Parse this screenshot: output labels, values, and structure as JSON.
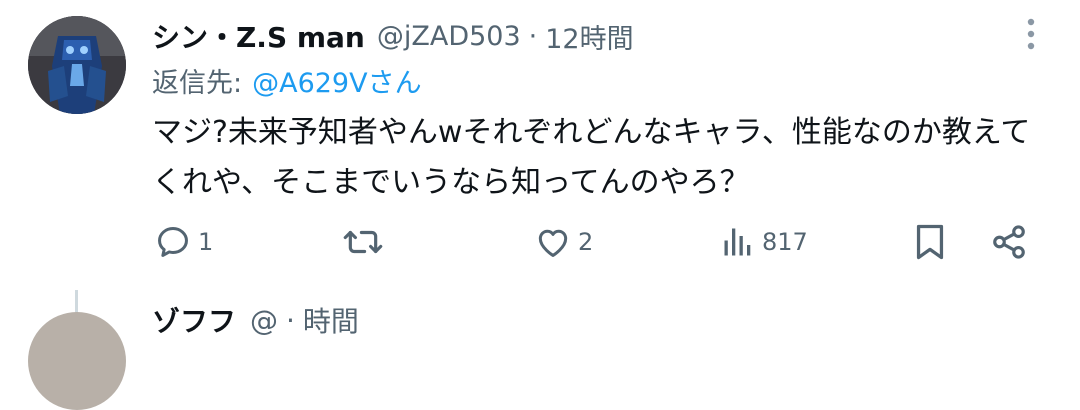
{
  "tweet": {
    "author_name": "シン・Z.S man",
    "handle": "@jZAD503",
    "separator": "·",
    "time": "12時間",
    "reply_label": "返信先:",
    "reply_handle": "@A629Vさん",
    "text": "マジ?未来予知者やんwそれぞれどんなキャラ、性能なのか教えてくれや、そこまでいうなら知ってんのやろ？",
    "actions": {
      "reply_icon": "reply-icon",
      "reply_count": "1",
      "retweet_icon": "retweet-icon",
      "like_icon": "heart-icon",
      "like_count": "2",
      "views_icon": "views-icon",
      "views_count": "817",
      "bookmark_icon": "bookmark-icon",
      "share_icon": "share-icon"
    }
  },
  "next_tweet": {
    "author_name": "ゾフフ",
    "handle": "@",
    "separator": "·",
    "time": "時間"
  },
  "colors": {
    "text_primary": "#0f1419",
    "text_secondary": "#536471",
    "link": "#1d9bf0",
    "icon": "#536471"
  }
}
